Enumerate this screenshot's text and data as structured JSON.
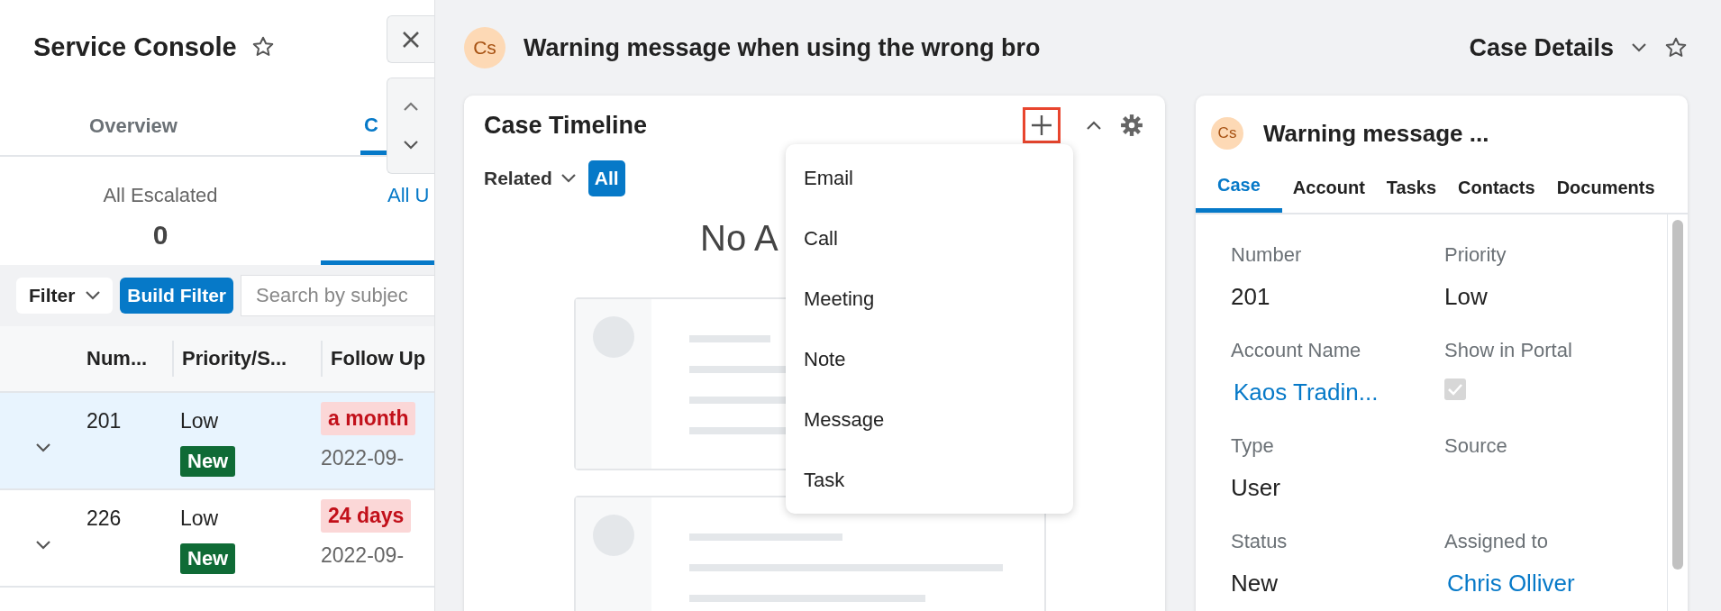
{
  "left_panel": {
    "title": "Service Console",
    "tabs": [
      {
        "label": "Overview",
        "selected": false
      },
      {
        "label": "C",
        "selected": true
      }
    ],
    "stats": [
      {
        "label": "All Escalated",
        "count": "0",
        "selected": false
      },
      {
        "label": "All U",
        "selected": true
      }
    ],
    "filter": {
      "label": "Filter",
      "build_button": "Build Filter",
      "search_placeholder": "Search by subjec"
    },
    "table": {
      "columns": [
        "Num...",
        "Priority/S...",
        "Follow Up"
      ],
      "rows": [
        {
          "number": "201",
          "priority": "Low",
          "status": "New",
          "follow_up": "a month",
          "date": "2022-09-",
          "selected": true
        },
        {
          "number": "226",
          "priority": "Low",
          "status": "New",
          "follow_up": "24 days",
          "date": "2022-09-",
          "selected": false
        }
      ]
    }
  },
  "case_header": {
    "avatar": "Cs",
    "title": "Warning message when using the wrong bro",
    "view": "Case Details"
  },
  "timeline": {
    "title": "Case Timeline",
    "filter": "Related",
    "all_button": "All",
    "empty_text": "No A",
    "menu_open": true,
    "menu": [
      "Email",
      "Call",
      "Meeting",
      "Note",
      "Message",
      "Task"
    ]
  },
  "details": {
    "avatar": "Cs",
    "title": "Warning message ...",
    "tabs": [
      {
        "label": "Case",
        "selected": true
      },
      {
        "label": "Account",
        "selected": false
      },
      {
        "label": "Tasks",
        "selected": false
      },
      {
        "label": "Contacts",
        "selected": false
      },
      {
        "label": "Documents",
        "selected": false
      }
    ],
    "fields": [
      {
        "label": "Number",
        "kind": "text",
        "value": "201"
      },
      {
        "label": "Priority",
        "kind": "text",
        "value": "Low"
      },
      {
        "label": "Account Name",
        "kind": "link",
        "value": "Kaos Tradin..."
      },
      {
        "label": "Show in Portal",
        "kind": "checkbox",
        "checked": true
      },
      {
        "label": "Type",
        "kind": "text",
        "value": "User"
      },
      {
        "label": "Source",
        "kind": "text"
      },
      {
        "label": "Status",
        "kind": "text",
        "value": "New"
      },
      {
        "label": "Assigned to",
        "kind": "link",
        "value": "Chris Olliver"
      }
    ]
  }
}
